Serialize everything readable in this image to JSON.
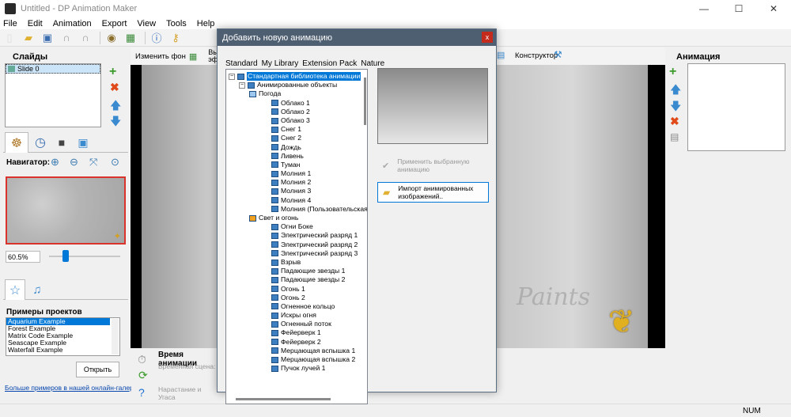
{
  "window": {
    "title": "Untitled - DP Animation Maker",
    "minimize": "—",
    "maximize": "☐",
    "close": "✕"
  },
  "menu": [
    "File",
    "Edit",
    "Animation",
    "Export",
    "View",
    "Tools",
    "Help"
  ],
  "toolbar": {
    "icons": [
      "new-icon",
      "open-icon",
      "save-icon",
      "undo-icon",
      "redo-icon",
      "preview-icon",
      "export-icon",
      "info-icon",
      "key-icon"
    ]
  },
  "slides": {
    "title": "Слайды",
    "items": [
      "Slide 0"
    ]
  },
  "navigator": {
    "label": "Навигатор:",
    "zoom": "60.5%",
    "zoom_fraction": 0.16
  },
  "projects": {
    "title": "Примеры проектов",
    "items": [
      "Aquarium Example",
      "Forest Example",
      "Matrix Code Example",
      "Seascape Example",
      "Waterfall Example"
    ],
    "open_button": "Открыть",
    "more_link": "Больше примеров в нашей онлайн-галерее"
  },
  "main_toolbar": {
    "change_bg": "Изменить фон",
    "select_effect_partial": "Выбр эффе",
    "constructor": "Конструктор"
  },
  "canvas": {
    "watermark": "Paints"
  },
  "animation_panel": {
    "title": "Анимация"
  },
  "animation_time": {
    "title": "Время анимации",
    "scene_label": "Временная сцена:",
    "fade_label": "Нарастание и Угаса"
  },
  "dialog": {
    "title": "Добавить новую анимацию",
    "close": "x",
    "tabs": [
      "Standard",
      "My Library",
      "Extension Pack",
      "Nature"
    ],
    "apply_button": "Применить выбранную анимацию",
    "import_button": "Импорт анимированных изображений.."
  },
  "tree": {
    "root": "Стандартная библиотека анимации",
    "group": "Анимированные объекты",
    "weather": "Погода",
    "weather_items": [
      "Облако 1",
      "Облако 2",
      "Облако 3",
      "Снег 1",
      "Снег 2",
      "Дождь",
      "Ливень",
      "Туман",
      "Молния 1",
      "Молния 2",
      "Молния 3",
      "Молния 4",
      "Молния (Пользовательская)"
    ],
    "fire": "Свет и огонь",
    "fire_items": [
      "Огни Боке",
      "Электрический разряд 1",
      "Электрический разряд 2",
      "Электрический разряд 3",
      "Взрыв",
      "Падающие звезды 1",
      "Падающие звезды 2",
      "Огонь 1",
      "Огонь 2",
      "Огненное кольцо",
      "Искры огня",
      "Огненный поток",
      "Фейерверк 1",
      "Фейерверк 2",
      "Мерцающая вспышка 1",
      "Мерцающая вспышка 2",
      "Пучок лучей 1"
    ]
  },
  "status": {
    "num": "NUM"
  }
}
